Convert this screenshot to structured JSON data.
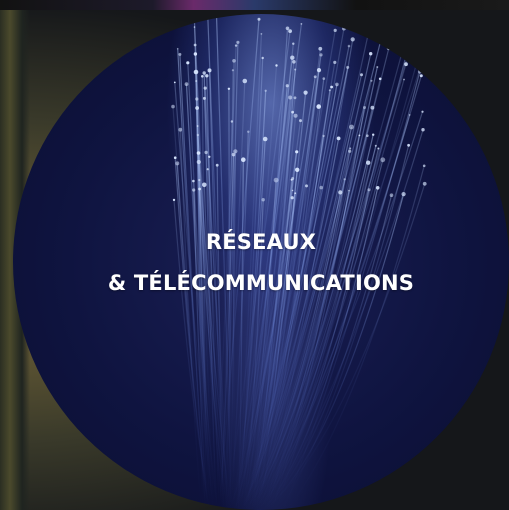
{
  "card": {
    "title_line_1": "RÉSEAUX",
    "title_line_2": "& TÉLÉCOMMUNICATIONS"
  },
  "colors": {
    "circle_background": "#0f1440",
    "fiber_glow": "#8fb4ff",
    "text": "#ffffff"
  }
}
